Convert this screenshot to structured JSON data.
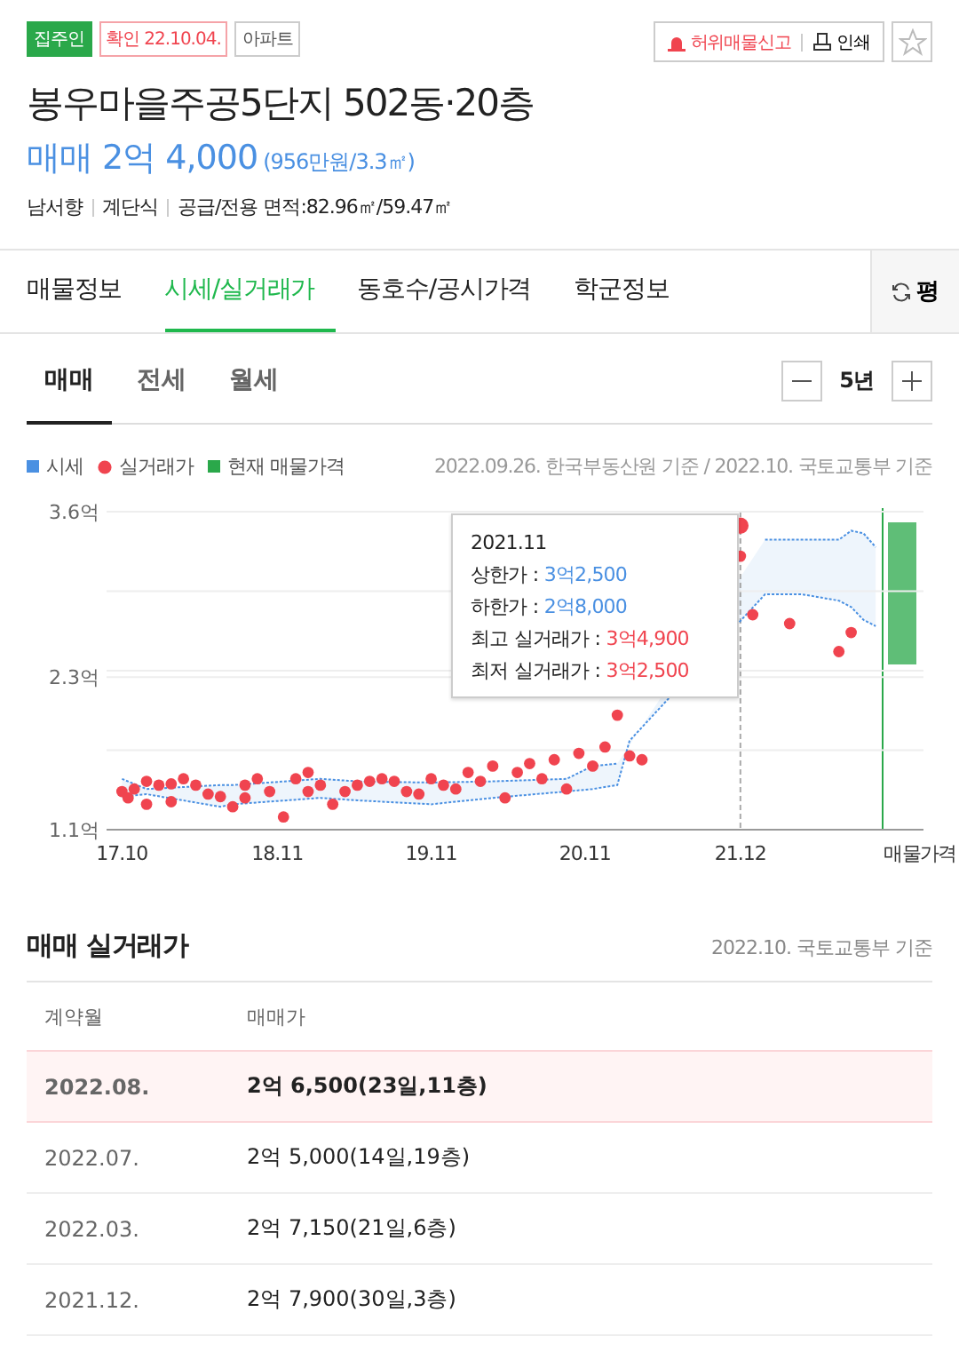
{
  "tags": [
    {
      "label": "집주인",
      "kind": "owner"
    },
    {
      "label": "확인 22.10.04.",
      "kind": "confirmed"
    },
    {
      "label": "아파트",
      "kind": "type"
    }
  ],
  "actions": {
    "report": "허위매물신고",
    "print": "인쇄",
    "favorite": false
  },
  "title": "봉우마을주공5단지 502동·20층",
  "price": {
    "main": "매매 2억 4,000",
    "sub": "(956만원/3.3㎡)"
  },
  "info": [
    "남서향",
    "계단식",
    "공급/전용 면적:82.96㎡/59.47㎡"
  ],
  "tabs": [
    {
      "label": "매물정보",
      "selected": false
    },
    {
      "label": "시세/실거래가",
      "selected": true
    },
    {
      "label": "동호수/공시가격",
      "selected": false
    },
    {
      "label": "학군정보",
      "selected": false
    }
  ],
  "unit_button": "평",
  "subtabs": [
    {
      "label": "매매",
      "selected": true
    },
    {
      "label": "전세",
      "selected": false
    },
    {
      "label": "월세",
      "selected": false
    }
  ],
  "period": "5년",
  "legend": [
    {
      "label": "시세",
      "kind": "square",
      "color": "#4a90e2"
    },
    {
      "kind": "dot",
      "color": "#f0444f"
    },
    {
      "label": "현재 매물가격",
      "kind": "square",
      "color": "#2aa84a"
    }
  ],
  "source": "2022.09.26. 한국부동산원 기준 / 2022.10. 국토교통부 기준",
  "chart_data": {
    "type": "scatter",
    "xlim": [
      17.0,
      22.31
    ],
    "ylim": [
      1.1,
      3.6
    ],
    "yticks": [
      {
        "value": 1.1,
        "label": "1.1억"
      },
      {
        "value": 2.3,
        "label": "2.3억"
      },
      {
        "value": 3.6,
        "label": "3.6억"
      }
    ],
    "xticks": [
      {
        "value": 17.1,
        "label": "17.10"
      },
      {
        "value": 18.11,
        "label": "18.11"
      },
      {
        "value": 19.11,
        "label": "19.11"
      },
      {
        "value": 20.11,
        "label": "20.11"
      },
      {
        "value": 21.12,
        "label": "21.12"
      }
    ],
    "x": [
      17.1,
      17.26,
      17.74,
      17.82,
      18.39,
      18.63,
      19.11,
      19.51,
      19.99,
      20.16,
      20.32,
      20.4,
      21.28,
      21.52,
      21.76,
      21.84,
      21.92,
      22.0,
      17.1,
      17.14,
      17.18,
      17.26,
      17.26,
      17.34,
      17.42,
      17.42,
      17.5,
      17.58,
      17.66,
      17.74,
      17.82,
      17.9,
      17.9,
      17.98,
      18.06,
      18.15,
      18.23,
      18.31,
      18.31,
      18.39,
      18.47,
      18.55,
      18.63,
      18.71,
      18.79,
      18.87,
      18.95,
      19.03,
      19.11,
      19.19,
      19.27,
      19.35,
      19.43,
      19.51,
      19.59,
      19.67,
      19.75,
      19.83,
      19.91,
      19.99,
      20.07,
      20.16,
      20.24,
      20.32,
      20.4,
      20.48,
      21.12,
      21.12,
      21.2,
      21.44,
      21.76,
      21.84
    ],
    "series": [
      {
        "name": "상한가",
        "type": "line",
        "line_style": "dotted",
        "color": "#4a90e2",
        "values": [
          1.5,
          1.42,
          1.45,
          1.45,
          1.5,
          1.48,
          1.47,
          1.48,
          1.5,
          1.6,
          1.62,
          null,
          3.38,
          3.38,
          3.38,
          3.45,
          3.43,
          3.32,
          null,
          null,
          null,
          null,
          null,
          null,
          null,
          null,
          null,
          null,
          null,
          null,
          null,
          null,
          null,
          null,
          null,
          null,
          null,
          null,
          null,
          null,
          null,
          null,
          null,
          null,
          null,
          null,
          null,
          null,
          null,
          null,
          null,
          null,
          null,
          null,
          null,
          null,
          null,
          null,
          null,
          null,
          null,
          null,
          null,
          null,
          null,
          null,
          null,
          null,
          null,
          null,
          null,
          null
        ]
      },
      {
        "name": "하한가",
        "type": "line",
        "line_style": "dotted",
        "color": "#4a90e2",
        "values": [
          1.36,
          1.38,
          1.28,
          1.3,
          1.35,
          1.33,
          1.3,
          1.35,
          1.4,
          1.42,
          1.45,
          1.8,
          2.95,
          2.95,
          2.9,
          2.85,
          2.75,
          2.7,
          null,
          null,
          null,
          null,
          null,
          null,
          null,
          null,
          null,
          null,
          null,
          null,
          null,
          null,
          null,
          null,
          null,
          null,
          null,
          null,
          null,
          null,
          null,
          null,
          null,
          null,
          null,
          null,
          null,
          null,
          null,
          null,
          null,
          null,
          null,
          null,
          null,
          null,
          null,
          null,
          null,
          null,
          null,
          null,
          null,
          null,
          null,
          null,
          null,
          null,
          null,
          null,
          null,
          null
        ]
      },
      {
        "name": "실거래가",
        "type": "scatter",
        "color": "#f0444f",
        "values": [
          null,
          null,
          null,
          null,
          null,
          null,
          null,
          null,
          null,
          null,
          null,
          null,
          null,
          null,
          null,
          null,
          null,
          null,
          1.4,
          1.35,
          1.42,
          1.3,
          1.48,
          1.45,
          1.32,
          1.46,
          1.5,
          1.45,
          1.38,
          1.36,
          1.28,
          1.45,
          1.35,
          1.5,
          1.4,
          1.2,
          1.5,
          1.55,
          1.4,
          1.45,
          1.3,
          1.4,
          1.45,
          1.48,
          1.5,
          1.48,
          1.4,
          1.38,
          1.5,
          1.45,
          1.42,
          1.55,
          1.48,
          1.6,
          1.35,
          1.55,
          1.62,
          1.5,
          1.65,
          1.42,
          1.7,
          1.6,
          1.75,
          2.0,
          1.68,
          1.65,
          3.49,
          3.25,
          2.79,
          2.72,
          2.5,
          2.65
        ]
      }
    ],
    "annotations": [
      "2021.11"
    ]
  },
  "offer_axis_label": "매물가격",
  "tooltip": {
    "sep": " : ",
    "rows": [
      {
        "value": "3억2,500",
        "kind": "estimate"
      },
      {
        "value": "2억8,000",
        "kind": "estimate"
      },
      {
        "label": "최고 실거래가",
        "value": "3억4,900",
        "kind": "trade"
      },
      {
        "label": "최저 실거래가",
        "value": "3억2,500",
        "kind": "trade"
      }
    ]
  },
  "trades": {
    "title": "매매 실거래가",
    "source": "2022.10. 국토교통부 기준",
    "columns": [
      "계약월",
      "매매가"
    ],
    "rows": [
      {
        "month": "2022.08.",
        "price": "2억 6,500(23일,11층)",
        "selected": true
      },
      {
        "month": "2022.07.",
        "price": "2억 5,000(14일,19층)",
        "selected": false
      },
      {
        "month": "2022.03.",
        "price": "2억 7,150(21일,6층)",
        "selected": false
      },
      {
        "month": "2021.12.",
        "price": "2억 7,900(30일,3층)",
        "selected": false
      }
    ]
  }
}
